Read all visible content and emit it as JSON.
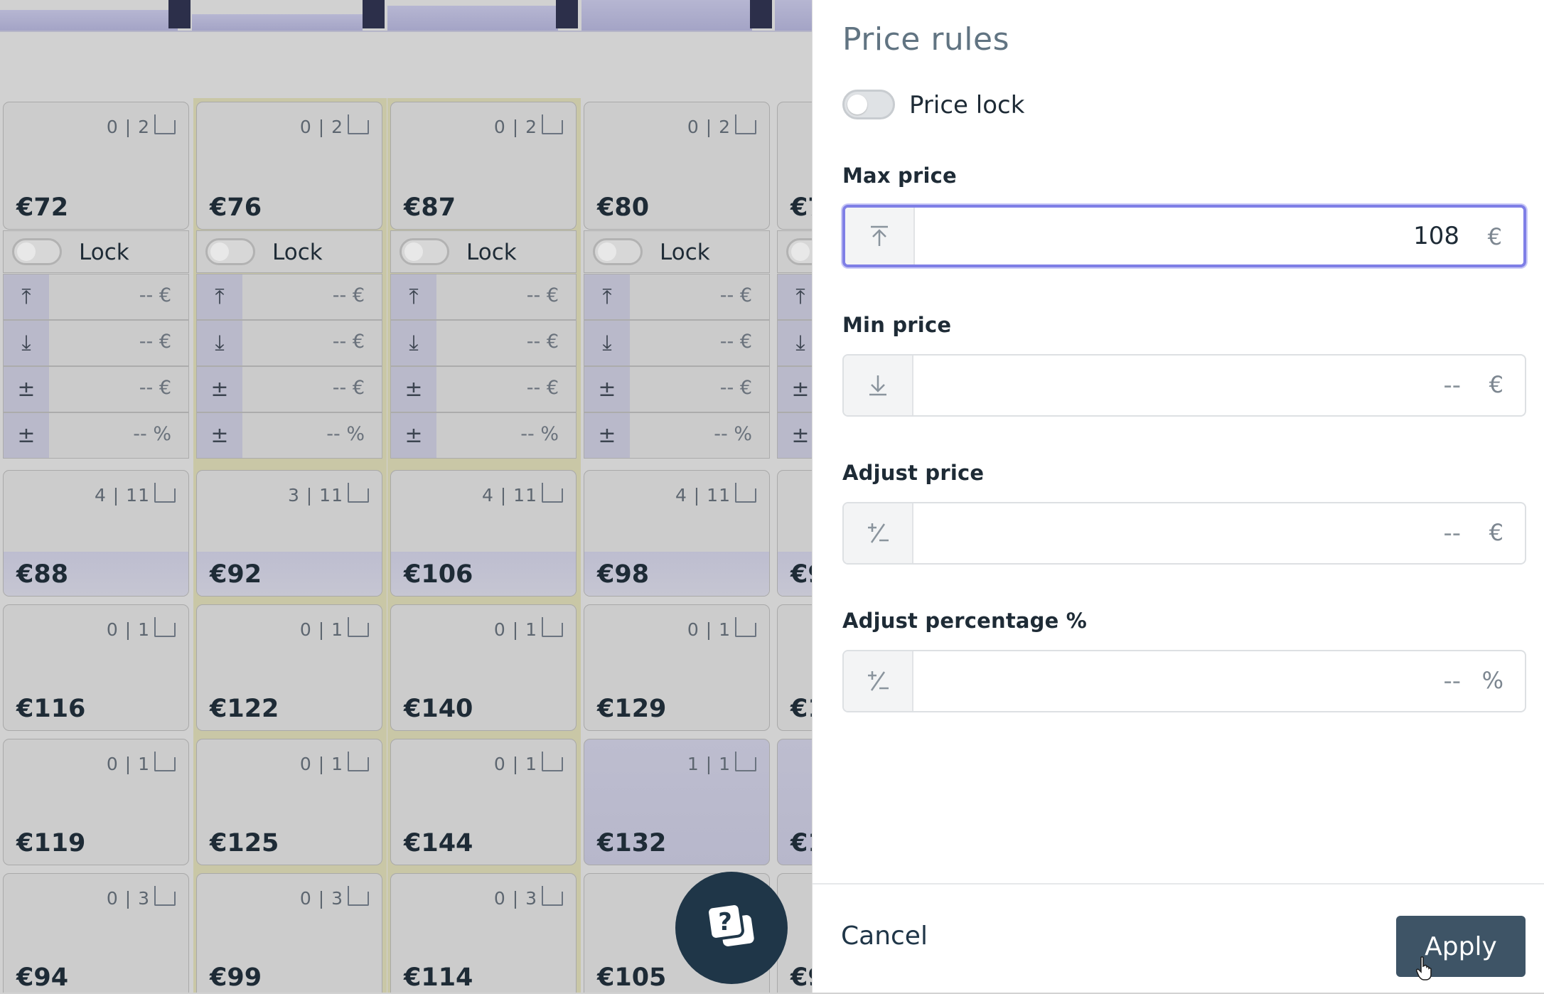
{
  "panel": {
    "title": "Price rules",
    "price_lock_label": "Price lock",
    "max_price": {
      "label": "Max price",
      "value": "108",
      "unit": "€"
    },
    "min_price": {
      "label": "Min price",
      "placeholder": "--",
      "unit": "€"
    },
    "adjust_price": {
      "label": "Adjust price",
      "placeholder": "--",
      "unit": "€"
    },
    "adjust_percentage": {
      "label": "Adjust percentage %",
      "placeholder": "--",
      "unit": "%"
    },
    "cancel_label": "Cancel",
    "apply_label": "Apply"
  },
  "grid": {
    "lock_label": "Lock",
    "rule_values": [
      "-- €",
      "-- €",
      "-- €",
      "-- %"
    ],
    "row1": {
      "avail": [
        "0 | 2",
        "0 | 2",
        "0 | 2",
        "0 | 2"
      ],
      "prices": [
        "€72",
        "€76",
        "€87",
        "€80",
        "€7"
      ]
    },
    "row2": {
      "avail": [
        "4 | 11",
        "3 | 11",
        "4 | 11",
        "4 | 11"
      ],
      "prices": [
        "€88",
        "€92",
        "€106",
        "€98",
        "€9"
      ]
    },
    "row3": {
      "avail": [
        "0 | 1",
        "0 | 1",
        "0 | 1",
        "0 | 1"
      ],
      "prices": [
        "€116",
        "€122",
        "€140",
        "€129",
        "€1"
      ]
    },
    "row4": {
      "avail": [
        "0 | 1",
        "0 | 1",
        "0 | 1",
        "1 | 1"
      ],
      "prices": [
        "€119",
        "€125",
        "€144",
        "€132",
        "€1"
      ]
    },
    "row5": {
      "avail": [
        "0 | 3",
        "0 | 3",
        "0 | 3"
      ],
      "prices": [
        "€94",
        "€99",
        "€114",
        "€105",
        "€9"
      ]
    }
  },
  "icons": {
    "max": "arrow-up-to-line-icon",
    "min": "arrow-down-to-line-icon",
    "adjust": "plus-minus-icon",
    "chat": "chat-support-icon"
  },
  "colors": {
    "accent": "#7f7fe6",
    "apply_bg": "#3e5466",
    "title": "#617482"
  }
}
